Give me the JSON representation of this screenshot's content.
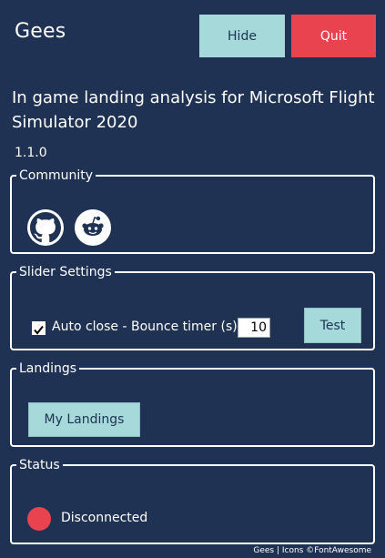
{
  "app": {
    "title": "Gees",
    "subtitle": "In game landing analysis for Microsoft Flight Simulator 2020",
    "version": "1.1.0"
  },
  "header": {
    "hide_label": "Hide",
    "quit_label": "Quit"
  },
  "community": {
    "legend": "Community",
    "links": [
      {
        "icon": "github-icon"
      },
      {
        "icon": "reddit-icon"
      }
    ]
  },
  "slider_settings": {
    "legend": "Slider Settings",
    "auto_close_checked": true,
    "auto_close_label": "Auto close - Bounce timer (s):",
    "bounce_timer_value": "10",
    "test_label": "Test"
  },
  "landings": {
    "legend": "Landings",
    "my_landings_label": "My Landings"
  },
  "status": {
    "legend": "Status",
    "text": "Disconnected",
    "indicator_color": "#e8434f"
  },
  "footer": {
    "text": "Gees | Icons ©FontAwesome"
  },
  "colors": {
    "background": "#1f3253",
    "accent": "#a5d9da",
    "danger": "#e8434f"
  }
}
